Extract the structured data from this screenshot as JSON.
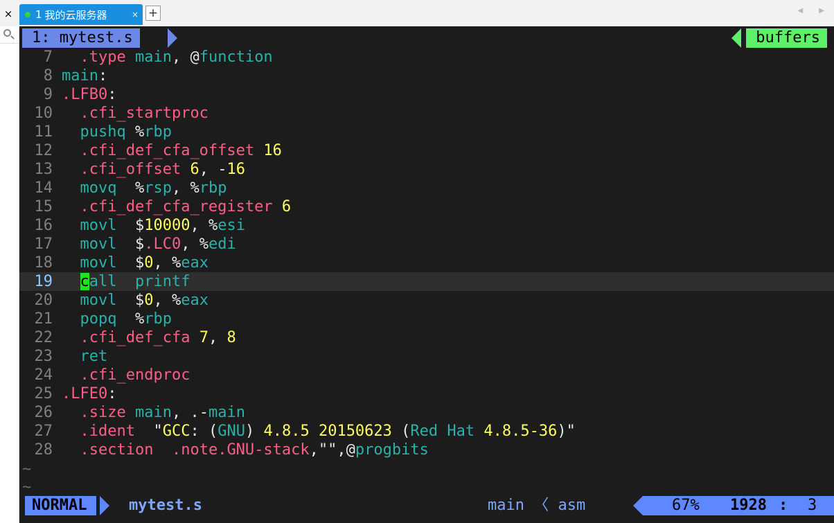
{
  "window": {
    "close_glyph": "×",
    "tab": {
      "number": "1",
      "title": "我的云服务器",
      "close_glyph": "×"
    },
    "new_tab_glyph": "+",
    "scroll_arrows": "◀ ▶"
  },
  "vim": {
    "buffer_tab": "1: mytest.s",
    "buffers_label": "buffers",
    "tilde": "~",
    "status": {
      "mode": "NORMAL",
      "filename": "mytest.s",
      "context": "main 〈 asm",
      "percent": "67%",
      "line": "1928",
      "sep": ":",
      "col": "3"
    },
    "lines": [
      {
        "n": "7",
        "segs": [
          [
            "  ",
            "t-wht"
          ],
          [
            ".type",
            "t-red"
          ],
          [
            " ",
            "t-wht"
          ],
          [
            "main",
            "t-teal"
          ],
          [
            ", @",
            "t-wht"
          ],
          [
            "function",
            "t-teal"
          ]
        ]
      },
      {
        "n": "8",
        "segs": [
          [
            "main",
            "t-teal"
          ],
          [
            ":",
            "t-wht"
          ]
        ]
      },
      {
        "n": "9",
        "segs": [
          [
            ".LFB0",
            "t-red"
          ],
          [
            ":",
            "t-wht"
          ]
        ]
      },
      {
        "n": "10",
        "segs": [
          [
            "  ",
            "t-wht"
          ],
          [
            ".cfi_startproc",
            "t-red"
          ]
        ]
      },
      {
        "n": "11",
        "segs": [
          [
            "  ",
            "t-wht"
          ],
          [
            "pushq",
            "t-teal"
          ],
          [
            " %",
            "t-wht"
          ],
          [
            "rbp",
            "t-teal"
          ]
        ]
      },
      {
        "n": "12",
        "segs": [
          [
            "  ",
            "t-wht"
          ],
          [
            ".cfi_def_cfa_offset",
            "t-red"
          ],
          [
            " ",
            "t-wht"
          ],
          [
            "16",
            "t-yel"
          ]
        ]
      },
      {
        "n": "13",
        "segs": [
          [
            "  ",
            "t-wht"
          ],
          [
            ".cfi_offset",
            "t-red"
          ],
          [
            " ",
            "t-wht"
          ],
          [
            "6",
            "t-yel"
          ],
          [
            ", -",
            "t-wht"
          ],
          [
            "16",
            "t-yel"
          ]
        ]
      },
      {
        "n": "14",
        "segs": [
          [
            "  ",
            "t-wht"
          ],
          [
            "movq",
            "t-teal"
          ],
          [
            "  %",
            "t-wht"
          ],
          [
            "rsp",
            "t-teal"
          ],
          [
            ", %",
            "t-wht"
          ],
          [
            "rbp",
            "t-teal"
          ]
        ]
      },
      {
        "n": "15",
        "segs": [
          [
            "  ",
            "t-wht"
          ],
          [
            ".cfi_def_cfa_register",
            "t-red"
          ],
          [
            " ",
            "t-wht"
          ],
          [
            "6",
            "t-yel"
          ]
        ]
      },
      {
        "n": "16",
        "segs": [
          [
            "  ",
            "t-wht"
          ],
          [
            "movl",
            "t-teal"
          ],
          [
            "  $",
            "t-wht"
          ],
          [
            "10000",
            "t-yel"
          ],
          [
            ", %",
            "t-wht"
          ],
          [
            "esi",
            "t-teal"
          ]
        ]
      },
      {
        "n": "17",
        "segs": [
          [
            "  ",
            "t-wht"
          ],
          [
            "movl",
            "t-teal"
          ],
          [
            "  $",
            "t-wht"
          ],
          [
            ".LC0",
            "t-red"
          ],
          [
            ", %",
            "t-wht"
          ],
          [
            "edi",
            "t-teal"
          ]
        ]
      },
      {
        "n": "18",
        "segs": [
          [
            "  ",
            "t-wht"
          ],
          [
            "movl",
            "t-teal"
          ],
          [
            "  $",
            "t-wht"
          ],
          [
            "0",
            "t-yel"
          ],
          [
            ", %",
            "t-wht"
          ],
          [
            "eax",
            "t-teal"
          ]
        ]
      },
      {
        "n": "19",
        "current": true,
        "segs": [
          [
            "  ",
            "t-wht"
          ],
          [
            "c",
            "cursor"
          ],
          [
            "all",
            "t-teal"
          ],
          [
            "  ",
            "t-wht"
          ],
          [
            "printf",
            "t-teal"
          ]
        ]
      },
      {
        "n": "20",
        "segs": [
          [
            "  ",
            "t-wht"
          ],
          [
            "movl",
            "t-teal"
          ],
          [
            "  $",
            "t-wht"
          ],
          [
            "0",
            "t-yel"
          ],
          [
            ", %",
            "t-wht"
          ],
          [
            "eax",
            "t-teal"
          ]
        ]
      },
      {
        "n": "21",
        "segs": [
          [
            "  ",
            "t-wht"
          ],
          [
            "popq",
            "t-teal"
          ],
          [
            "  %",
            "t-wht"
          ],
          [
            "rbp",
            "t-teal"
          ]
        ]
      },
      {
        "n": "22",
        "segs": [
          [
            "  ",
            "t-wht"
          ],
          [
            ".cfi_def_cfa",
            "t-red"
          ],
          [
            " ",
            "t-wht"
          ],
          [
            "7",
            "t-yel"
          ],
          [
            ", ",
            "t-wht"
          ],
          [
            "8",
            "t-yel"
          ]
        ]
      },
      {
        "n": "23",
        "segs": [
          [
            "  ",
            "t-wht"
          ],
          [
            "ret",
            "t-teal"
          ]
        ]
      },
      {
        "n": "24",
        "segs": [
          [
            "  ",
            "t-wht"
          ],
          [
            ".cfi_endproc",
            "t-red"
          ]
        ]
      },
      {
        "n": "25",
        "segs": [
          [
            ".LFE0",
            "t-red"
          ],
          [
            ":",
            "t-wht"
          ]
        ]
      },
      {
        "n": "26",
        "segs": [
          [
            "  ",
            "t-wht"
          ],
          [
            ".size",
            "t-red"
          ],
          [
            " ",
            "t-wht"
          ],
          [
            "main",
            "t-teal"
          ],
          [
            ", .-",
            "t-wht"
          ],
          [
            "main",
            "t-teal"
          ]
        ]
      },
      {
        "n": "27",
        "segs": [
          [
            "  ",
            "t-wht"
          ],
          [
            ".ident",
            "t-red"
          ],
          [
            "  \"",
            "t-wht"
          ],
          [
            "GCC",
            "t-yel"
          ],
          [
            ": (",
            "t-wht"
          ],
          [
            "GNU",
            "t-teal"
          ],
          [
            ") ",
            "t-wht"
          ],
          [
            "4.8.5 20150623",
            "t-yel"
          ],
          [
            " (",
            "t-wht"
          ],
          [
            "Red Hat",
            "t-teal"
          ],
          [
            " ",
            "t-wht"
          ],
          [
            "4.8.5-36",
            "t-yel"
          ],
          [
            ")\"",
            "t-wht"
          ]
        ]
      },
      {
        "n": "28",
        "segs": [
          [
            "  ",
            "t-wht"
          ],
          [
            ".section",
            "t-red"
          ],
          [
            "  ",
            "t-wht"
          ],
          [
            ".note.GNU-stack",
            "t-red"
          ],
          [
            ",\"\",@",
            "t-wht"
          ],
          [
            "progbits",
            "t-teal"
          ]
        ]
      }
    ]
  }
}
